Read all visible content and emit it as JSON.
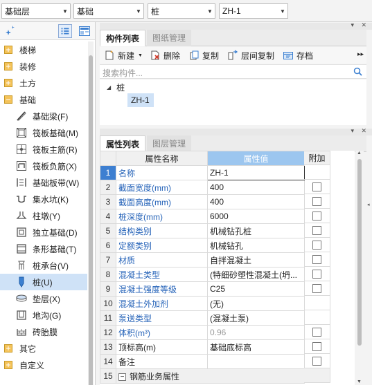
{
  "topbar": {
    "floor": "基础层",
    "category": "基础",
    "type": "桩",
    "component": "ZH-1"
  },
  "left_tree": {
    "groups": [
      {
        "label": "楼梯",
        "icon": "folder-plus-icon"
      },
      {
        "label": "装修",
        "icon": "folder-plus-icon"
      },
      {
        "label": "土方",
        "icon": "folder-plus-icon"
      },
      {
        "label": "基础",
        "icon": "folder-minus-icon"
      }
    ],
    "children": [
      {
        "label": "基础梁(F)",
        "icon": "foundation-beam-icon"
      },
      {
        "label": "筏板基础(M)",
        "icon": "raft-foundation-icon"
      },
      {
        "label": "筏板主筋(R)",
        "icon": "raft-main-rebar-icon"
      },
      {
        "label": "筏板负筋(X)",
        "icon": "raft-negative-rebar-icon"
      },
      {
        "label": "基础板带(W)",
        "icon": "foundation-strip-icon"
      },
      {
        "label": "集水坑(K)",
        "icon": "sump-pit-icon"
      },
      {
        "label": "柱墩(Y)",
        "icon": "column-pier-icon"
      },
      {
        "label": "独立基础(D)",
        "icon": "isolated-foundation-icon"
      },
      {
        "label": "条形基础(T)",
        "icon": "strip-foundation-icon"
      },
      {
        "label": "桩承台(V)",
        "icon": "pile-cap-icon"
      },
      {
        "label": "桩(U)",
        "icon": "pile-icon"
      },
      {
        "label": "垫层(X)",
        "icon": "cushion-layer-icon"
      },
      {
        "label": "地沟(G)",
        "icon": "trench-icon"
      },
      {
        "label": "砖胎膜",
        "icon": "brick-mold-icon"
      }
    ],
    "tail_groups": [
      {
        "label": "其它",
        "icon": "folder-plus-icon"
      },
      {
        "label": "自定义",
        "icon": "folder-plus-icon"
      }
    ]
  },
  "component_panel": {
    "tabs": [
      "构件列表",
      "图纸管理"
    ],
    "toolbar": {
      "new": "新建",
      "delete": "删除",
      "copy": "复制",
      "floor_copy": "层间复制",
      "save": "存档"
    },
    "search_placeholder": "搜索构件...",
    "tree_root": "桩",
    "tree_item": "ZH-1"
  },
  "property_panel": {
    "tabs": [
      "属性列表",
      "图层管理"
    ],
    "headers": {
      "name": "属性名称",
      "value": "属性值",
      "extra": "附加"
    },
    "rows": [
      {
        "n": "1",
        "name": "名称",
        "value": "ZH-1",
        "blue": true,
        "checkbox": false
      },
      {
        "n": "2",
        "name": "截面宽度(mm)",
        "value": "400",
        "blue": true,
        "checkbox": true
      },
      {
        "n": "3",
        "name": "截面高度(mm)",
        "value": "400",
        "blue": true,
        "checkbox": true
      },
      {
        "n": "4",
        "name": "桩深度(mm)",
        "value": "6000",
        "blue": true,
        "checkbox": true
      },
      {
        "n": "5",
        "name": "结构类别",
        "value": "机械钻孔桩",
        "blue": true,
        "checkbox": true
      },
      {
        "n": "6",
        "name": "定额类别",
        "value": "机械钻孔",
        "blue": true,
        "checkbox": true
      },
      {
        "n": "7",
        "name": "材质",
        "value": "自拌混凝土",
        "blue": true,
        "checkbox": true
      },
      {
        "n": "8",
        "name": "混凝土类型",
        "value": "(特细砂塑性混凝土(坍...",
        "blue": true,
        "checkbox": true
      },
      {
        "n": "9",
        "name": "混凝土强度等级",
        "value": "C25",
        "blue": true,
        "checkbox": true
      },
      {
        "n": "10",
        "name": "混凝土外加剂",
        "value": "(无)",
        "blue": true,
        "checkbox": false
      },
      {
        "n": "11",
        "name": "泵送类型",
        "value": "(混凝土泵)",
        "blue": true,
        "checkbox": false
      },
      {
        "n": "12",
        "name": "体积(m³)",
        "value": "0.96",
        "blue": true,
        "checkbox": true
      },
      {
        "n": "13",
        "name": "顶标高(m)",
        "value": "基础底标高",
        "blue": false,
        "checkbox": true
      },
      {
        "n": "14",
        "name": "备注",
        "value": "",
        "blue": false,
        "checkbox": true
      },
      {
        "n": "15",
        "name": "钢筋业务属性",
        "value": "",
        "blue": false,
        "checkbox": false,
        "group": true
      }
    ]
  }
}
